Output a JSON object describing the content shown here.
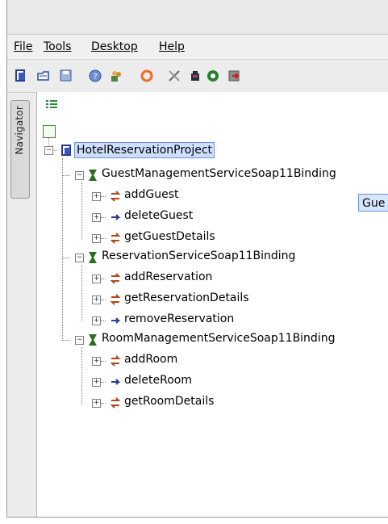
{
  "menu": {
    "items": [
      "File",
      "Tools",
      "Desktop",
      "Help"
    ]
  },
  "toolbar": {
    "icons": [
      "project-icon",
      "open-icon",
      "save-icon",
      "info-icon",
      "users-icon",
      "refresh-icon",
      "tools-icon",
      "bottle-icon",
      "lifebuoy-icon",
      "exit-icon"
    ]
  },
  "side_tab": {
    "label": "Navigator"
  },
  "tree": {
    "root": "HotelReservationProject",
    "bindings": [
      {
        "label": "GuestManagementServiceSoap11Binding",
        "ops": [
          {
            "label": "addGuest",
            "kind": "request-response"
          },
          {
            "label": "deleteGuest",
            "kind": "one-way"
          },
          {
            "label": "getGuestDetails",
            "kind": "request-response"
          }
        ]
      },
      {
        "label": "ReservationServiceSoap11Binding",
        "ops": [
          {
            "label": "addReservation",
            "kind": "request-response"
          },
          {
            "label": "getReservationDetails",
            "kind": "request-response"
          },
          {
            "label": "removeReservation",
            "kind": "one-way"
          }
        ]
      },
      {
        "label": "RoomManagementServiceSoap11Binding",
        "ops": [
          {
            "label": "addRoom",
            "kind": "request-response"
          },
          {
            "label": "deleteRoom",
            "kind": "one-way"
          },
          {
            "label": "getRoomDetails",
            "kind": "request-response"
          }
        ]
      }
    ]
  },
  "tooltip": {
    "text": "Gue"
  }
}
